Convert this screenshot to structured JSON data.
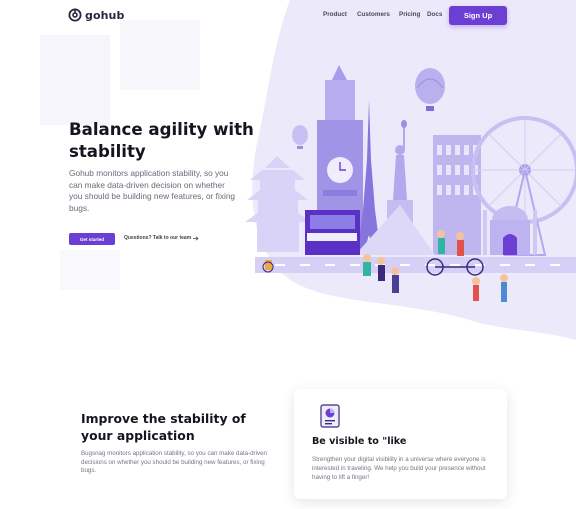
{
  "brand": {
    "name": "gohub",
    "accent": "#6b3fd4",
    "background_tint": "#ece9fb"
  },
  "nav": {
    "links": [
      "Product",
      "Customers",
      "Pricing",
      "Docs"
    ],
    "signup_label": "Sign Up"
  },
  "hero": {
    "title": "Balance agility with stability",
    "description": "Gohub monitors application stability, so you can make data-driven decision on whether you should be building new features, or fixing bugs.",
    "cta_label": "Get started",
    "secondary_link": "Questions? Talk to our team",
    "secondary_icon": "arrow-right-icon",
    "illustration": "travel-landmarks-illustration"
  },
  "section": {
    "title": "Improve the stability of your application",
    "description": "Bugsnag monitors application stability, so you can make data-driven decisions on whether you should be building new features, or fixing bugs."
  },
  "feature_card": {
    "icon": "document-chart-icon",
    "title": "Be visible to \"like",
    "description": "Strengthen your digital visibility in a universe where everyone is interested in traveling. We help you build your presence without having to lift a finger!"
  }
}
